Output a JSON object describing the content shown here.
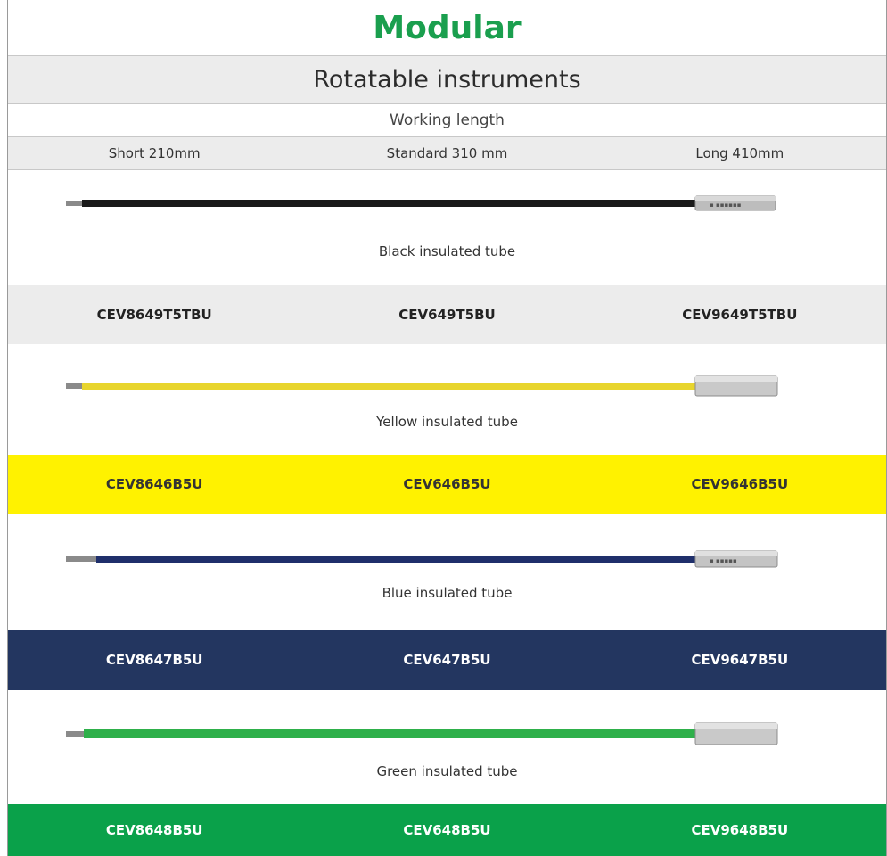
{
  "title": "Modular",
  "subtitle": "Rotatable instruments",
  "working_length_label": "Working length",
  "lengths": [
    "Short 210mm",
    "Standard 310 mm",
    "Long 410mm"
  ],
  "colors": {
    "title_green": "#1a9f4e",
    "black_tube": "#1a1a1a",
    "yellow_tube": "#e8d52e",
    "blue_tube": "#1f2f6b",
    "green_tube": "#2eb04a",
    "yellow_band": "#fff200",
    "navy_band": "#233660",
    "green_band": "#0aa14a",
    "grey_band": "#ececec"
  },
  "sections": [
    {
      "caption": "Black insulated tube",
      "tube_icon": "black-tube-icon",
      "codes": [
        "CEV8649T5TBU",
        "CEV649T5BU",
        "CEV9649T5TBU"
      ]
    },
    {
      "caption": "Yellow insulated tube",
      "tube_icon": "yellow-tube-icon",
      "codes": [
        "CEV8646B5U",
        "CEV646B5U",
        "CEV9646B5U"
      ]
    },
    {
      "caption": "Blue insulated tube",
      "tube_icon": "blue-tube-icon",
      "codes": [
        "CEV8647B5U",
        "CEV647B5U",
        "CEV9647B5U"
      ]
    },
    {
      "caption": "Green insulated tube",
      "tube_icon": "green-tube-icon",
      "codes": [
        "CEV8648B5U",
        "CEV648B5U",
        "CEV9648B5U"
      ]
    }
  ]
}
